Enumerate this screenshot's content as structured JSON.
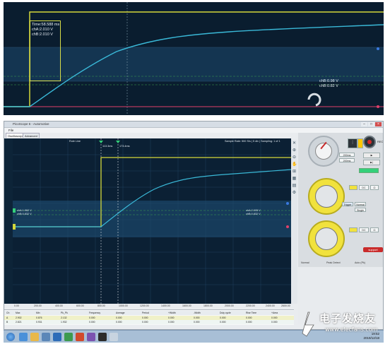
{
  "top_scope": {
    "cursor_readout": [
      "Time:58.588 ms",
      "chA:2.010 V",
      "chB:2.010 V"
    ],
    "right_readout": [
      "chB:0.98 V",
      "chB:0.82 V"
    ]
  },
  "app": {
    "title": "PicoScope 6 - Automotive",
    "menu": "File",
    "tabs": [
      "Oscilloscope",
      "Advanced"
    ],
    "scope_label": "Rule Line",
    "scope_right_info": "Sample Rate: 500 S/s | 5 div | Sampling: 1 of 1",
    "cursor_labels": [
      "113.3ms",
      "173.4ms"
    ],
    "left_cursor_vals": [
      "chA:1.962 V",
      "chB:0.832 V"
    ],
    "right_cursor_vals": [
      "chA:2.005 V",
      "chB:0.832 V"
    ],
    "x_ticks": [
      "0.00",
      "200.00",
      "400.00",
      "600.00",
      "800.00",
      "1000.00",
      "1200.00",
      "1400.00",
      "1600.00",
      "1800.00",
      "2000.00",
      "2200.00",
      "2400.00",
      "2600.00"
    ],
    "meas_headers": [
      "Ch",
      "Max",
      "Min",
      "Pk_Pk",
      "Frequency",
      "Average",
      "Period",
      "+Width",
      "-Width",
      "Duty cycle",
      "Rise Time",
      "+Area"
    ],
    "meas_rows": [
      [
        "A",
        "2.902",
        "0.876",
        "2.132",
        "0.000",
        "0.000",
        "0.000",
        "0.000",
        "0.000",
        "0.000",
        "0.000",
        "0.000"
      ],
      [
        "B",
        "2.821",
        "0.931",
        "1.932",
        "0.000",
        "0.000",
        "0.000",
        "0.000",
        "0.000",
        "0.000",
        "0.000",
        "0.000"
      ]
    ],
    "controls": {
      "rec_label": "REC",
      "timebase_value": "200ms",
      "range_value": "200ms",
      "trigger_buttons": [
        "Trigger",
        "Normal",
        "Single"
      ],
      "support_label": "support",
      "bottom_options": [
        "Normal",
        "Peak Detect",
        "Auto (Pk)"
      ]
    }
  },
  "taskbar": {
    "time": "19:52",
    "date": "2019/12/18"
  },
  "watermark": {
    "title": "电子发烧友",
    "url": "www.elecfans.com"
  },
  "colors": {
    "trace_a": "#d5d83a",
    "trace_b": "#3ab9d8",
    "ref_green": "#34d07a",
    "ref_magenta": "#e0406a",
    "bg_scope": "#0c2236"
  }
}
